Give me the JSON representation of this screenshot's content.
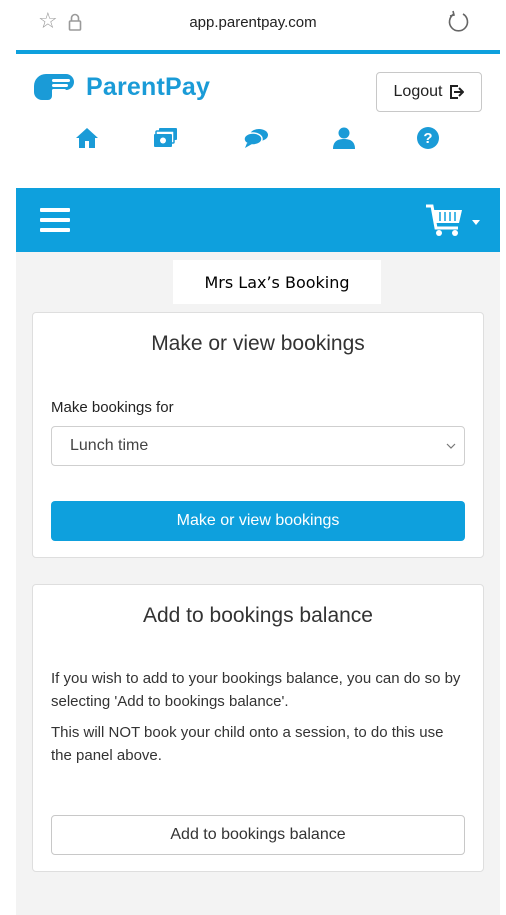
{
  "browser": {
    "url": "app.parentpay.com",
    "icons": [
      "star-icon",
      "lock-icon",
      "reload-icon"
    ]
  },
  "header": {
    "logo_text": "ParentPay",
    "logout_label": "Logout",
    "nav_icons": [
      "home-icon",
      "payments-icon",
      "messages-icon",
      "profile-icon",
      "help-icon"
    ]
  },
  "colors": {
    "brand_blue": "#0ea0dd",
    "icon_blue": "#1a9bd7",
    "background": "#f3f3f3"
  },
  "page": {
    "title": "Mrs Lax’s Booking"
  },
  "bookings_panel": {
    "heading": "Make or view bookings",
    "field_label": "Make bookings for",
    "selected_option": "Lunch time",
    "button_label": "Make or view bookings"
  },
  "balance_panel": {
    "heading": "Add to bookings balance",
    "paragraph_1": "If you wish to add to your bookings balance, you can do so by selecting 'Add to bookings balance'.",
    "paragraph_2": "This will NOT book your child onto a session, to do this use the panel above.",
    "button_label": "Add to bookings balance"
  }
}
